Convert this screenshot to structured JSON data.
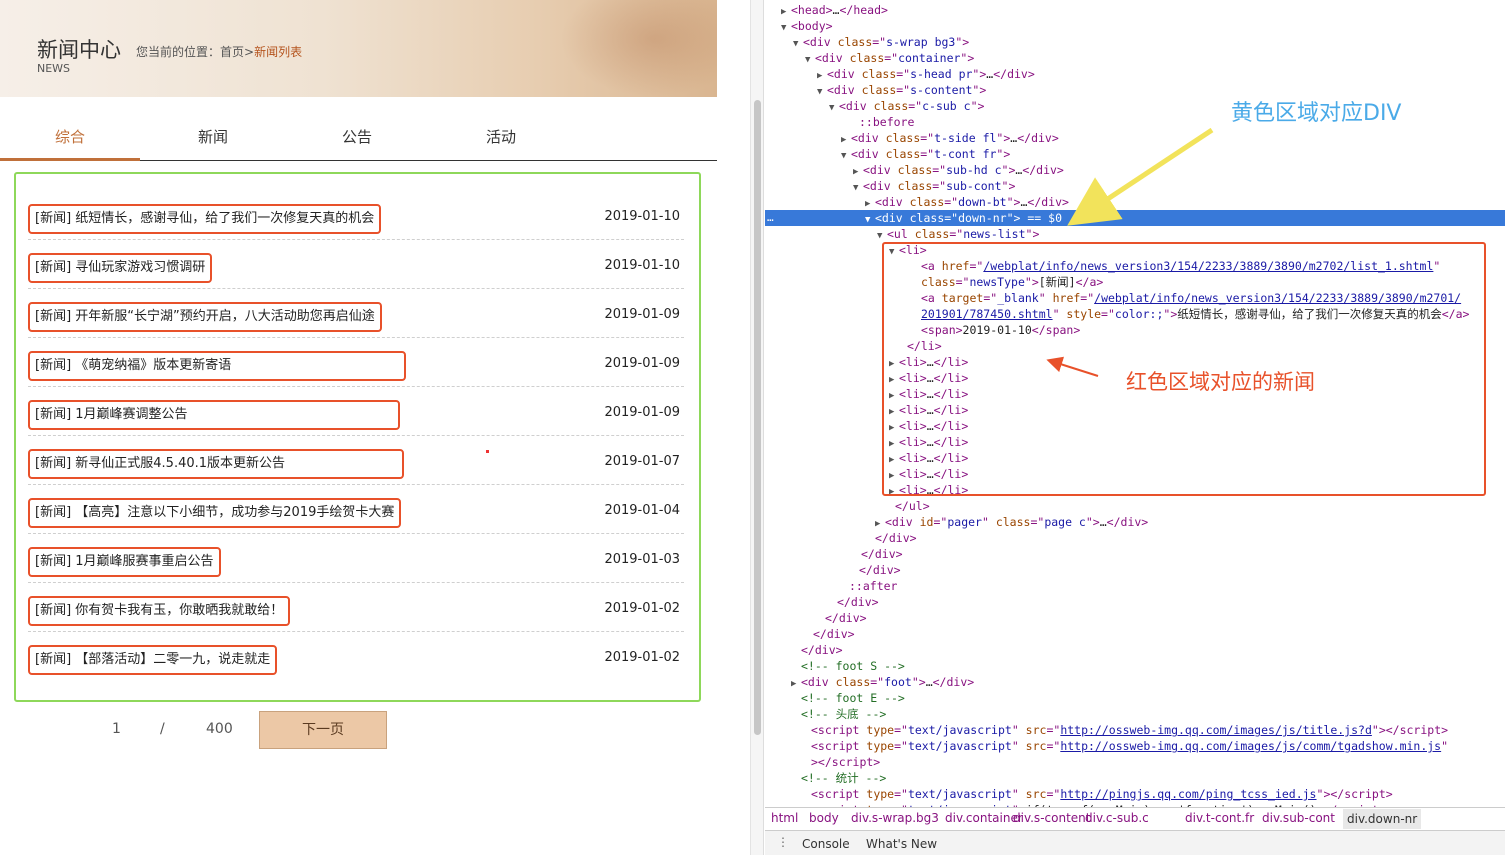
{
  "header": {
    "title": "新闻中心",
    "subtitle": "NEWS",
    "breadcrumb_prefix": "您当前的位置：首页>",
    "breadcrumb_current": "新闻列表"
  },
  "tabs": [
    {
      "label": "综合",
      "active": true
    },
    {
      "label": "新闻",
      "active": false
    },
    {
      "label": "公告",
      "active": false
    },
    {
      "label": "活动",
      "active": false
    }
  ],
  "news": [
    {
      "title": "[新闻] 纸短情长，感谢寻仙，给了我们一次修复天真的机会",
      "date": "2019-01-10"
    },
    {
      "title": "[新闻] 寻仙玩家游戏习惯调研",
      "date": "2019-01-10"
    },
    {
      "title": "[新闻] 开年新服“长宁湖”预约开启，八大活动助您再启仙途",
      "date": "2019-01-09"
    },
    {
      "title": "[新闻] 《萌宠纳福》版本更新寄语",
      "date": "2019-01-09"
    },
    {
      "title": "[新闻] 1月巅峰赛调整公告",
      "date": "2019-01-09"
    },
    {
      "title": "[新闻] 新寻仙正式服4.5.40.1版本更新公告",
      "date": "2019-01-07"
    },
    {
      "title": "[新闻] 【高亮】注意以下小细节，成功参与2019手绘贺卡大赛",
      "date": "2019-01-04"
    },
    {
      "title": "[新闻] 1月巅峰服赛事重启公告",
      "date": "2019-01-03"
    },
    {
      "title": "[新闻] 你有贺卡我有玉，你敢晒我就敢给！",
      "date": "2019-01-02"
    },
    {
      "title": "[新闻] 【部落活动】二零一九，说走就走",
      "date": "2019-01-02"
    }
  ],
  "pager": {
    "current": "1",
    "separator": "/",
    "total": "400",
    "next_label": "下一页"
  },
  "annotations": {
    "yellow": "黄色区域对应DIV",
    "red": "红色区域对应的新闻",
    "yellow_color": "#f2e35b",
    "red_color": "#e8512a",
    "green_color": "#8ed85a"
  },
  "dom_lines": [
    {
      "html": "<span class='arrow'>▶</span><span class='t'>&lt;head&gt;</span><span class='tx'>…</span><span class='t'>&lt;/head&gt;</span>"
    },
    {
      "html": "<span class='arrow'>▼</span><span class='t'>&lt;body&gt;</span>"
    },
    {
      "html": "<span class='arrow'>▼</span><span class='t'>&lt;div </span><span class='an'>class</span>=\"<span class='av'>s-wrap bg3</span>\"<span class='t'>&gt;</span>"
    },
    {
      "html": "<span class='arrow'>▼</span><span class='t'>&lt;div </span><span class='an'>class</span>=\"<span class='av'>container</span>\"<span class='t'>&gt;</span>"
    },
    {
      "html": "<span class='arrow'>▶</span><span class='t'>&lt;div </span><span class='an'>class</span>=\"<span class='av'>s-head pr</span>\"<span class='t'>&gt;</span><span class='tx'>…</span><span class='t'>&lt;/div&gt;</span>"
    },
    {
      "html": "<span class='arrow'>▼</span><span class='t'>&lt;div </span><span class='an'>class</span>=\"<span class='av'>s-content</span>\"<span class='t'>&gt;</span>"
    },
    {
      "html": "<span class='arrow'>▼</span><span class='t'>&lt;div </span><span class='an'>class</span>=\"<span class='av'>c-sub c</span>\"<span class='t'>&gt;</span>"
    },
    {
      "html": "<span class='arrow'></span><span class='ps'>::before</span>"
    },
    {
      "html": "<span class='arrow'>▶</span><span class='t'>&lt;div </span><span class='an'>class</span>=\"<span class='av'>t-side fl</span>\"<span class='t'>&gt;</span><span class='tx'>…</span><span class='t'>&lt;/div&gt;</span>"
    },
    {
      "html": "<span class='arrow'>▼</span><span class='t'>&lt;div </span><span class='an'>class</span>=\"<span class='av'>t-cont fr</span>\"<span class='t'>&gt;</span>"
    },
    {
      "html": "<span class='arrow'>▶</span><span class='t'>&lt;div </span><span class='an'>class</span>=\"<span class='av'>sub-hd c</span>\"<span class='t'>&gt;</span><span class='tx'>…</span><span class='t'>&lt;/div&gt;</span>"
    },
    {
      "html": "<span class='arrow'>▼</span><span class='t'>&lt;div </span><span class='an'>class</span>=\"<span class='av'>sub-cont</span>\"<span class='t'>&gt;</span>"
    },
    {
      "html": "<span class='arrow'>▶</span><span class='t'>&lt;div </span><span class='an'>class</span>=\"<span class='av'>down-bt</span>\"<span class='t'>&gt;</span><span class='tx'>…</span><span class='t'>&lt;/div&gt;</span>"
    },
    {
      "html": "<span class='arrow'>▼</span><span class='t'>&lt;div </span><span class='an'>class</span>=\"<span class='av'>down-nr</span>\"<span class='t'>&gt;</span> == $0"
    },
    {
      "html": "<span class='arrow'>▼</span><span class='t'>&lt;ul </span><span class='an'>class</span>=\"<span class='av'>news-list</span>\"<span class='t'>&gt;</span>"
    },
    {
      "html": "<span class='arrow'>▼</span><span class='t'>&lt;li&gt;</span>"
    },
    {
      "html": "<span class='arrow'></span><span class='t'>&lt;a </span><span class='an'>href</span>=\"<span class='lk'>/webplat/info/news_version3/154/2233/3889/3890/m2702/list_1.shtml</span>\""
    },
    {
      "html": "<span class='arrow'></span><span class='an'>class</span>=\"<span class='av'>newsType</span>\"<span class='t'>&gt;</span><span class='tx'>[新闻]</span><span class='t'>&lt;/a&gt;</span>"
    },
    {
      "html": "<span class='arrow'></span><span class='t'>&lt;a </span><span class='an'>target</span>=\"<span class='av'>_blank</span>\" <span class='an'>href</span>=\"<span class='lk'>/webplat/info/news_version3/154/2233/3889/3890/m2701/</span>"
    },
    {
      "html": "<span class='arrow'></span><span class='lk'>201901/787450.shtml</span>\" <span class='an'>style</span>=\"<span class='av'>color:;</span>\"<span class='t'>&gt;</span><span class='tx'>纸短情长，感谢寻仙，给了我们一次修复天真的机会</span><span class='t'>&lt;/a&gt;</span>"
    },
    {
      "html": "<span class='arrow'></span><span class='t'>&lt;span&gt;</span><span class='tx'>2019-01-10</span><span class='t'>&lt;/span&gt;</span>"
    },
    {
      "html": "<span class='arrow'></span><span class='t'>&lt;/li&gt;</span>"
    },
    {
      "html": "<span class='arrow'>▶</span><span class='t'>&lt;li&gt;</span><span class='tx'>…</span><span class='t'>&lt;/li&gt;</span>"
    },
    {
      "html": "<span class='arrow'>▶</span><span class='t'>&lt;li&gt;</span><span class='tx'>…</span><span class='t'>&lt;/li&gt;</span>"
    },
    {
      "html": "<span class='arrow'>▶</span><span class='t'>&lt;li&gt;</span><span class='tx'>…</span><span class='t'>&lt;/li&gt;</span>"
    },
    {
      "html": "<span class='arrow'>▶</span><span class='t'>&lt;li&gt;</span><span class='tx'>…</span><span class='t'>&lt;/li&gt;</span>"
    },
    {
      "html": "<span class='arrow'>▶</span><span class='t'>&lt;li&gt;</span><span class='tx'>…</span><span class='t'>&lt;/li&gt;</span>"
    },
    {
      "html": "<span class='arrow'>▶</span><span class='t'>&lt;li&gt;</span><span class='tx'>…</span><span class='t'>&lt;/li&gt;</span>"
    },
    {
      "html": "<span class='arrow'>▶</span><span class='t'>&lt;li&gt;</span><span class='tx'>…</span><span class='t'>&lt;/li&gt;</span>"
    },
    {
      "html": "<span class='arrow'>▶</span><span class='t'>&lt;li&gt;</span><span class='tx'>…</span><span class='t'>&lt;/li&gt;</span>"
    },
    {
      "html": "<span class='arrow'>▶</span><span class='t'>&lt;li&gt;</span><span class='tx'>…</span><span class='t'>&lt;/li&gt;</span>"
    },
    {
      "html": "<span class='arrow'></span><span class='t'>&lt;/ul&gt;</span>"
    },
    {
      "html": "<span class='arrow'>▶</span><span class='t'>&lt;div </span><span class='an'>id</span>=\"<span class='av'>pager</span>\" <span class='an'>class</span>=\"<span class='av'>page c</span>\"<span class='t'>&gt;</span><span class='tx'>…</span><span class='t'>&lt;/div&gt;</span>"
    },
    {
      "html": "<span class='arrow'></span><span class='t'>&lt;/div&gt;</span>"
    },
    {
      "html": "<span class='arrow'></span><span class='t'>&lt;/div&gt;</span>"
    },
    {
      "html": "<span class='arrow'></span><span class='t'>&lt;/div&gt;</span>"
    },
    {
      "html": "<span class='arrow'></span><span class='ps'>::after</span>"
    },
    {
      "html": "<span class='arrow'></span><span class='t'>&lt;/div&gt;</span>"
    },
    {
      "html": "<span class='arrow'></span><span class='t'>&lt;/div&gt;</span>"
    },
    {
      "html": "<span class='arrow'></span><span class='t'>&lt;/div&gt;</span>"
    },
    {
      "html": "<span class='arrow'></span><span class='t'>&lt;/div&gt;</span>"
    },
    {
      "html": "<span class='arrow'></span><span class='cm'>&lt;!-- foot S  --&gt;</span>"
    },
    {
      "html": "<span class='arrow'>▶</span><span class='t'>&lt;div </span><span class='an'>class</span>=\"<span class='av'>foot</span>\"<span class='t'>&gt;</span><span class='tx'>…</span><span class='t'>&lt;/div&gt;</span>"
    },
    {
      "html": "<span class='arrow'></span><span class='cm'>&lt;!-- foot E  --&gt;</span>"
    },
    {
      "html": "<span class='arrow'></span><span class='cm'>&lt;!-- 头底 --&gt;</span>"
    },
    {
      "html": "<span class='arrow'></span><span class='t'>&lt;script </span><span class='an'>type</span>=\"<span class='av'>text/javascript</span>\" <span class='an'>src</span>=\"<span class='lk'>http://ossweb-img.qq.com/images/js/title.js?d</span>\"<span class='t'>&gt;&lt;/script&gt;</span>"
    },
    {
      "html": "<span class='arrow'></span><span class='t'>&lt;script </span><span class='an'>type</span>=\"<span class='av'>text/javascript</span>\" <span class='an'>src</span>=\"<span class='lk'>http://ossweb-img.qq.com/images/js/comm/tgadshow.min.js</span>\""
    },
    {
      "html": "<span class='arrow'></span><span class='t'>&gt;&lt;/script&gt;</span>"
    },
    {
      "html": "<span class='arrow'></span><span class='cm'>&lt;!-- 统计 --&gt;</span>"
    },
    {
      "html": "<span class='arrow'></span><span class='t'>&lt;script </span><span class='an'>type</span>=\"<span class='av'>text/javascript</span>\" <span class='an'>src</span>=\"<span class='lk'>http://pingjs.qq.com/ping_tcss_ied.js</span>\"<span class='t'>&gt;&lt;/script&gt;</span>"
    },
    {
      "html": "<span class='arrow'></span><span class='t'>&lt;script </span><span class='an'>type</span>=\"<span class='av'>text/javascript</span>\"<span class='t'>&gt;</span><span class='tx'>if(typeof(pgvMain) == 'function')pgvMain();</span><span class='t'>&lt;/script&gt;</span>"
    }
  ],
  "breadcrumbs": [
    "html",
    "body",
    "div.s-wrap.bg3",
    "div.container",
    "div.s-content",
    "div.c-sub.c",
    "div.t-cont.fr",
    "div.sub-cont",
    "div.down-nr"
  ],
  "drawer": {
    "menu_icon": "more-vert-icon",
    "menu_glyph": "⋮",
    "tab1": "Console",
    "tab2": "What's New"
  }
}
